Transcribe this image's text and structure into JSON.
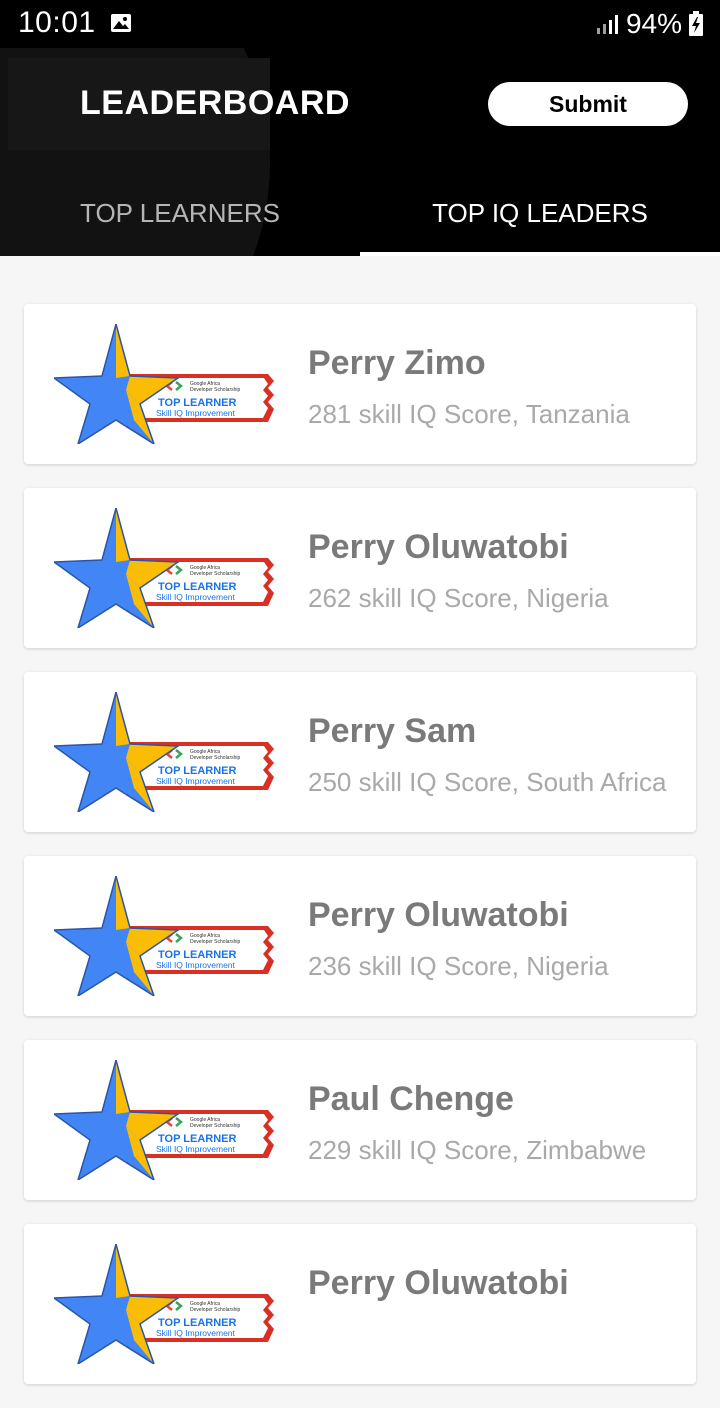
{
  "status_bar": {
    "time": "10:01",
    "battery": "94%"
  },
  "app_bar": {
    "title": "LEADERBOARD",
    "submit_label": "Submit"
  },
  "tabs": [
    {
      "label": "TOP LEARNERS",
      "active": false
    },
    {
      "label": "TOP IQ LEADERS",
      "active": true
    }
  ],
  "badge": {
    "line1": "Google Africa",
    "line2": "Developer Scholarship",
    "title": "TOP LEARNER",
    "subtitle": "Skill IQ Improvement"
  },
  "leaders": [
    {
      "name": "Perry Zimo",
      "score": "281",
      "score_suffix": "skill IQ Score,",
      "country": "Tanzania"
    },
    {
      "name": "Perry Oluwatobi",
      "score": "262",
      "score_suffix": "skill IQ Score,",
      "country": "Nigeria"
    },
    {
      "name": "Perry Sam",
      "score": "250",
      "score_suffix": "skill IQ Score,",
      "country": "South Africa"
    },
    {
      "name": "Perry Oluwatobi",
      "score": "236",
      "score_suffix": "skill IQ Score,",
      "country": "Nigeria"
    },
    {
      "name": "Paul Chenge",
      "score": "229",
      "score_suffix": "skill IQ Score,",
      "country": "Zimbabwe"
    },
    {
      "name": "Perry Oluwatobi",
      "score": "",
      "score_suffix": "",
      "country": ""
    }
  ],
  "colors": {
    "app_bar": "#000000",
    "background": "#f6f6f6",
    "star_blue": "#4285f4",
    "star_yellow": "#fbbc05",
    "ribbon_red": "#d93025",
    "badge_title_blue": "#1a73e8"
  }
}
